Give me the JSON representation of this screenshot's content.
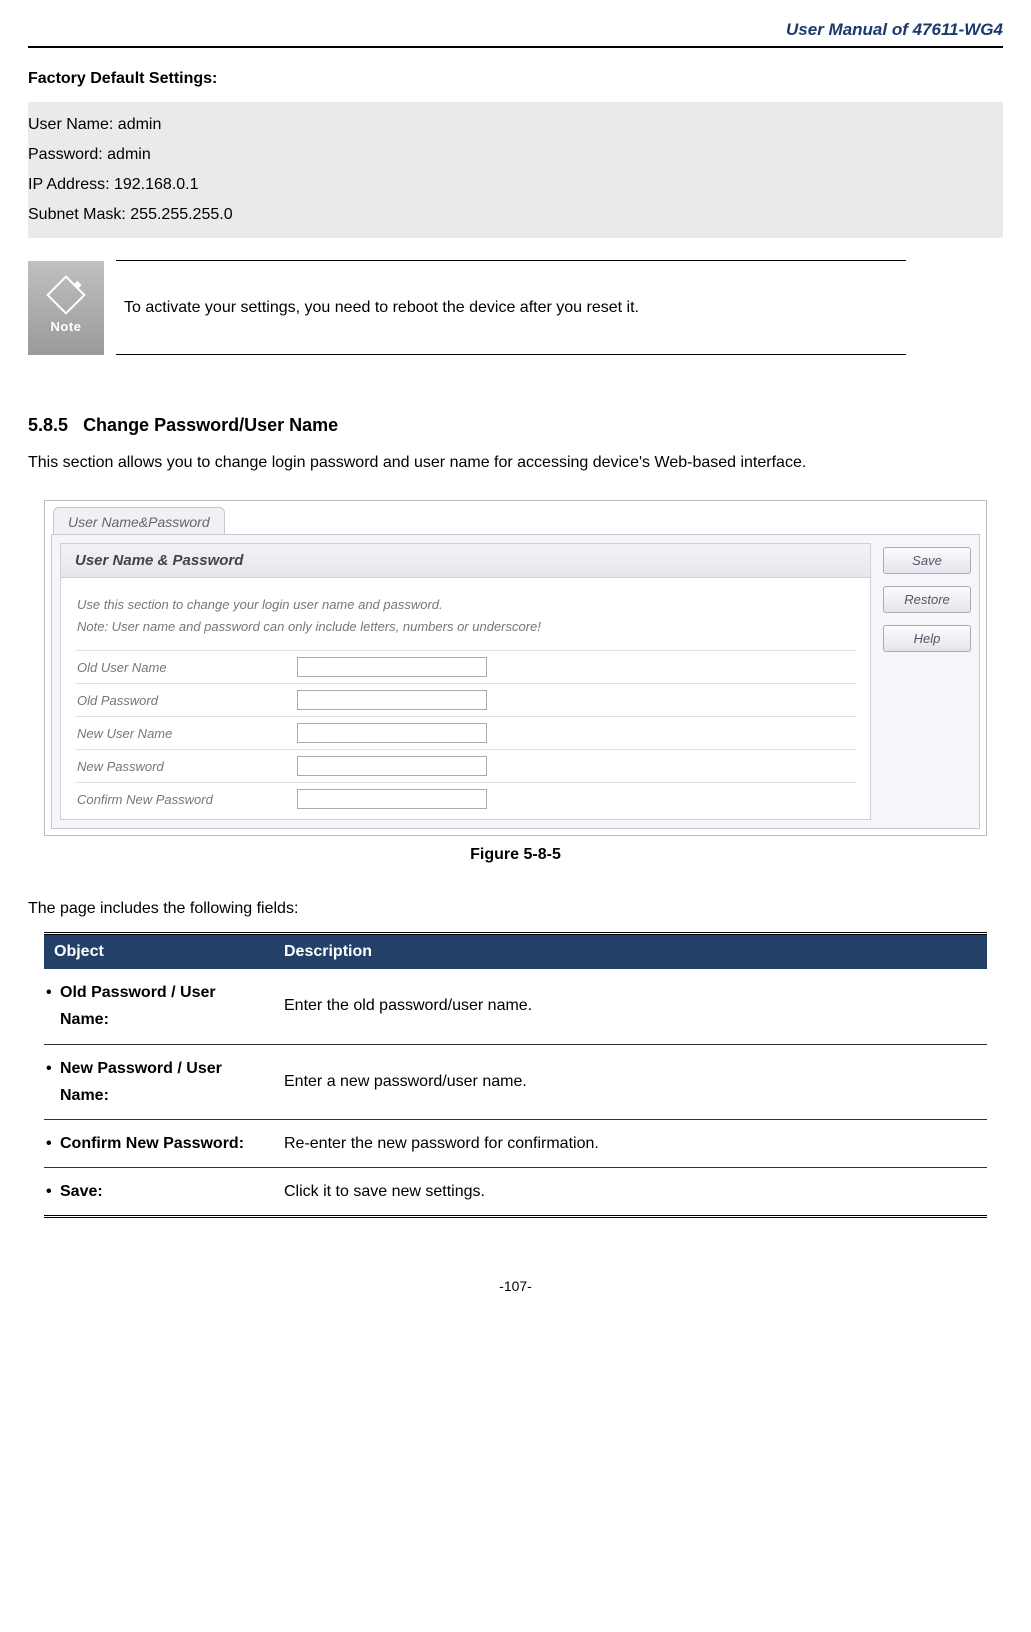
{
  "header": {
    "title": "User Manual of 47611-WG4"
  },
  "factory_defaults": {
    "heading": "Factory Default Settings:",
    "rows": [
      "User Name: admin",
      "Password: admin",
      "IP Address: 192.168.0.1",
      "Subnet Mask: 255.255.255.0"
    ]
  },
  "note": {
    "icon_label": "Note",
    "text": "To activate your settings, you need to reboot the device after you reset it."
  },
  "subsection": {
    "number": "5.8.5",
    "title": "Change Password/User Name",
    "desc": "This section allows you to change login password and user name for accessing device's Web-based interface."
  },
  "screenshot": {
    "tab": "User Name&Password",
    "panel_title": "User Name & Password",
    "instructions_line1": "Use this section to change your login user name and password.",
    "instructions_line2": "Note: User name and password can only include letters, numbers or underscore!",
    "fields": [
      "Old User Name",
      "Old Password",
      "New User Name",
      "New Password",
      "Confirm New Password"
    ],
    "buttons": {
      "save": "Save",
      "restore": "Restore",
      "help": "Help"
    }
  },
  "figure_caption": "Figure 5-8-5",
  "fields_intro": "The page includes the following fields:",
  "fields_table": {
    "headers": {
      "object": "Object",
      "description": "Description"
    },
    "rows": [
      {
        "object": "Old Password / User Name:",
        "description": "Enter the old password/user name."
      },
      {
        "object": "New Password / User Name:",
        "description": "Enter a new password/user name."
      },
      {
        "object": "Confirm New Password:",
        "description": "Re-enter the new password for confirmation."
      },
      {
        "object": "Save:",
        "description": "Click it to save new settings."
      }
    ]
  },
  "footer": {
    "page": "-107-"
  }
}
